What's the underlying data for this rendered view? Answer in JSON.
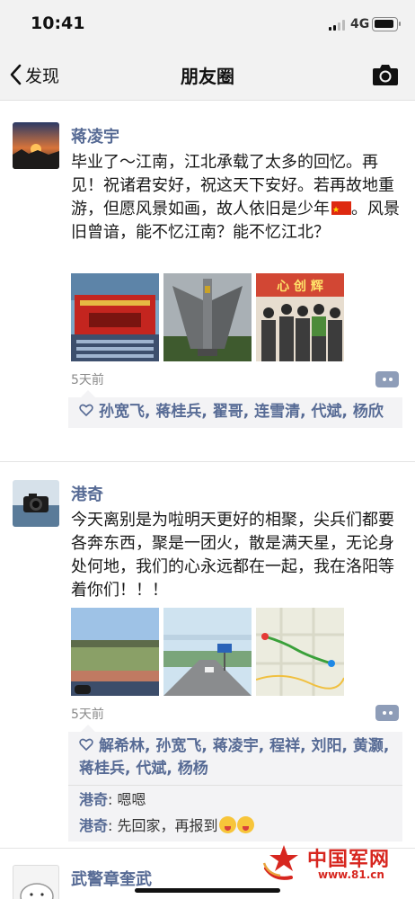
{
  "status_bar": {
    "time": "10:41",
    "network": "4G"
  },
  "nav": {
    "back_label": "发现",
    "title": "朋友圈"
  },
  "posts": [
    {
      "author": "蒋凌宇",
      "text_line1": "毕业了～江南，江北承载了太多的回忆。再见！祝诸君安好，祝这天下安好。若再故地重游，但愿风景如画，故人依旧是少年",
      "text_line2": "。风景旧曾谙，能不忆江南？能不忆江北？",
      "photo_banner_text": "心 创 辉",
      "time": "5天前",
      "likes": "孙宽飞, 蒋桂兵, 翟哥, 连雪清, 代斌, 杨欣"
    },
    {
      "author": "港奇",
      "text": "今天离别是为啦明天更好的相聚，尖兵们都要各奔东西，聚是一团火，散是满天星，无论身处何地，我们的心永远都在一起，我在洛阳等着你们！！！",
      "time": "5天前",
      "likes": "解希林, 孙宽飞, 蒋凌宇, 程祥, 刘阳, 黄灏, 蒋桂兵, 代斌, 杨杨",
      "comments": [
        {
          "author": "港奇",
          "text": ": 嗯嗯"
        },
        {
          "author": "港奇",
          "text": ": 先回家，再报到"
        }
      ]
    },
    {
      "author": "武警章奎武"
    }
  ],
  "watermark": {
    "title": "中国军网",
    "url": "www.81.cn"
  },
  "colors": {
    "link": "#576b95",
    "accent_red": "#d7261f",
    "topbar": "#f2f2f2"
  }
}
